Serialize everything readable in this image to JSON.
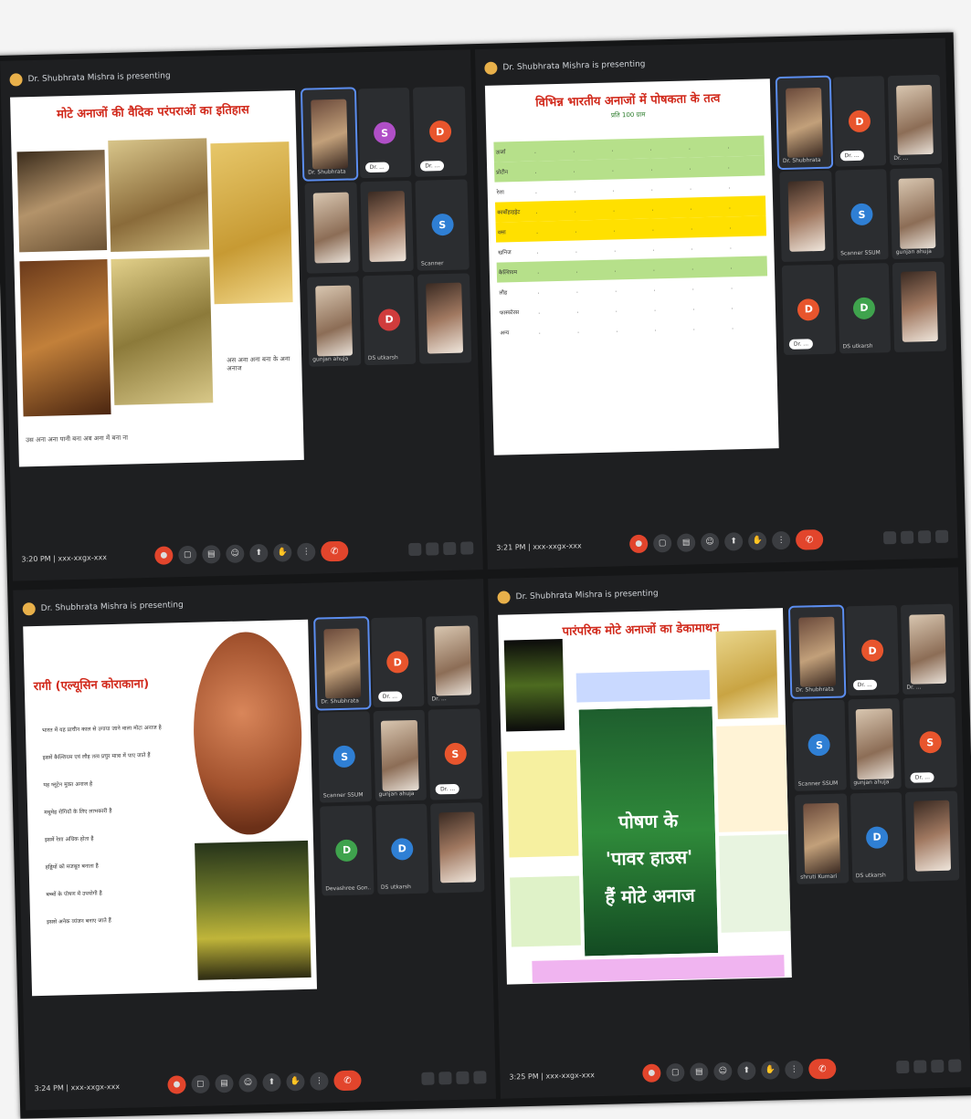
{
  "colors": {
    "accent_red": "#e2452c",
    "title_red": "#d12a1c",
    "highlight_green": "#b6e08a",
    "highlight_yellow": "#ffe000",
    "active_tile": "#5b8def"
  },
  "icons": [
    "mic-icon",
    "camera-icon",
    "caption-icon",
    "emoji-icon",
    "present-icon",
    "raise-hand-icon",
    "more-icon",
    "end-call-icon",
    "info-icon",
    "people-icon",
    "chat-icon",
    "activities-icon"
  ],
  "panels": [
    {
      "presenter": "Dr. Shubhrata Mishra is presenting",
      "clock": "3:20 PM",
      "meeting": "xxx-xxgx-xxx",
      "slide_title": "मोटे अनाजों की वैदिक परंपराओं का इतिहास",
      "captions": [
        "अस अना अना बना के अना अनाज",
        "उस अना अना पानी बना अब अना में बना ना"
      ],
      "tiles": [
        {
          "name": "Dr. Shubhrata",
          "kind": "photo"
        },
        {
          "name": "Dr. ...",
          "kind": "icon",
          "letter": "S",
          "color": "p"
        },
        {
          "name": "Dr. ...",
          "kind": "letter",
          "letter": "D",
          "color": "r"
        },
        {
          "name": "",
          "kind": "photo"
        },
        {
          "name": "",
          "kind": "photo"
        },
        {
          "name": "Scanner",
          "kind": "letter",
          "letter": "S",
          "color": "b"
        },
        {
          "name": "gunjan ahuja",
          "kind": "photo"
        },
        {
          "name": "DS utkarsh",
          "kind": "letter",
          "letter": "D",
          "color": "c"
        },
        {
          "name": "",
          "kind": "photo"
        }
      ]
    },
    {
      "presenter": "Dr. Shubhrata Mishra is presenting",
      "clock": "3:21 PM",
      "meeting": "xxx-xxgx-xxx",
      "slide_title": "विभिन्न भारतीय अनाजों में पोषकता के तत्व",
      "slide_subtitle": "प्रति 100 ग्राम",
      "table_rows": [
        "ऊर्जा",
        "प्रोटीन",
        "रेशा",
        "कार्बोहाइड्रेट",
        "वसा",
        "खनिज",
        "कैल्शियम",
        "लौह",
        "फास्फोरस",
        "अन्य"
      ],
      "tiles": [
        {
          "name": "Dr. Shubhrata",
          "kind": "photo"
        },
        {
          "name": "Dr. ...",
          "kind": "letter",
          "letter": "D",
          "color": "r"
        },
        {
          "name": "Dr. ...",
          "kind": "photo"
        },
        {
          "name": "",
          "kind": "photo"
        },
        {
          "name": "Scanner SSUM",
          "kind": "letter",
          "letter": "S",
          "color": "b"
        },
        {
          "name": "gunjan ahuja",
          "kind": "photo"
        },
        {
          "name": "Dr. ...",
          "kind": "letter",
          "letter": "D",
          "color": "r"
        },
        {
          "name": "DS utkarsh",
          "kind": "letter",
          "letter": "D",
          "color": "g"
        },
        {
          "name": "",
          "kind": "photo"
        }
      ]
    },
    {
      "presenter": "Dr. Shubhrata Mishra is presenting",
      "clock": "3:24 PM",
      "meeting": "xxx-xxgx-xxx",
      "slide_title": "रागी (एल्यूसिन कोराकाना)",
      "bullets": [
        "भारत में यह प्राचीन काल से उगाया जाने वाला मोटा अनाज है",
        "इसमें कैल्शियम एवं लौह तत्व प्रचुर मात्रा में पाए जाते हैं",
        "यह ग्लूटेन मुक्त अनाज है",
        "मधुमेह रोगियों के लिए लाभकारी है",
        "इसमें रेशा अधिक होता है",
        "हड्डियों को मजबूत बनाता है",
        "बच्चों के पोषण में उपयोगी है",
        "इससे अनेक व्यंजन बनाए जाते हैं"
      ],
      "tiles": [
        {
          "name": "Dr. Shubhrata",
          "kind": "photo"
        },
        {
          "name": "Dr. ...",
          "kind": "letter",
          "letter": "D",
          "color": "r"
        },
        {
          "name": "Dr. ...",
          "kind": "photo"
        },
        {
          "name": "Scanner SSUM",
          "kind": "letter",
          "letter": "S",
          "color": "b"
        },
        {
          "name": "gunjan ahuja",
          "kind": "photo"
        },
        {
          "name": "Dr. ...",
          "kind": "letter",
          "letter": "S",
          "color": "r"
        },
        {
          "name": "Devashree Gon...",
          "kind": "letter",
          "letter": "D",
          "color": "g"
        },
        {
          "name": "DS utkarsh",
          "kind": "letter",
          "letter": "D",
          "color": "b"
        },
        {
          "name": "",
          "kind": "photo"
        }
      ]
    },
    {
      "presenter": "Dr. Shubhrata Mishra is presenting",
      "clock": "3:25 PM",
      "meeting": "xxx-xxgx-xxx",
      "slide_title": "पारंपरिक मोटे अनाजों का डेकामाथन",
      "poster_line1": "पोषण के",
      "poster_line2": "'पावर हाउस'",
      "poster_line3": "हैं मोटे अनाज",
      "tiles": [
        {
          "name": "Dr. Shubhrata",
          "kind": "photo"
        },
        {
          "name": "Dr. ...",
          "kind": "letter",
          "letter": "D",
          "color": "r"
        },
        {
          "name": "Dr. ...",
          "kind": "photo"
        },
        {
          "name": "Scanner SSUM",
          "kind": "letter",
          "letter": "S",
          "color": "b"
        },
        {
          "name": "gunjan ahuja",
          "kind": "photo"
        },
        {
          "name": "Dr. ...",
          "kind": "letter",
          "letter": "S",
          "color": "r"
        },
        {
          "name": "shruti Kumari",
          "kind": "photo"
        },
        {
          "name": "DS utkarsh",
          "kind": "letter",
          "letter": "D",
          "color": "b"
        },
        {
          "name": "",
          "kind": "photo"
        }
      ]
    }
  ]
}
